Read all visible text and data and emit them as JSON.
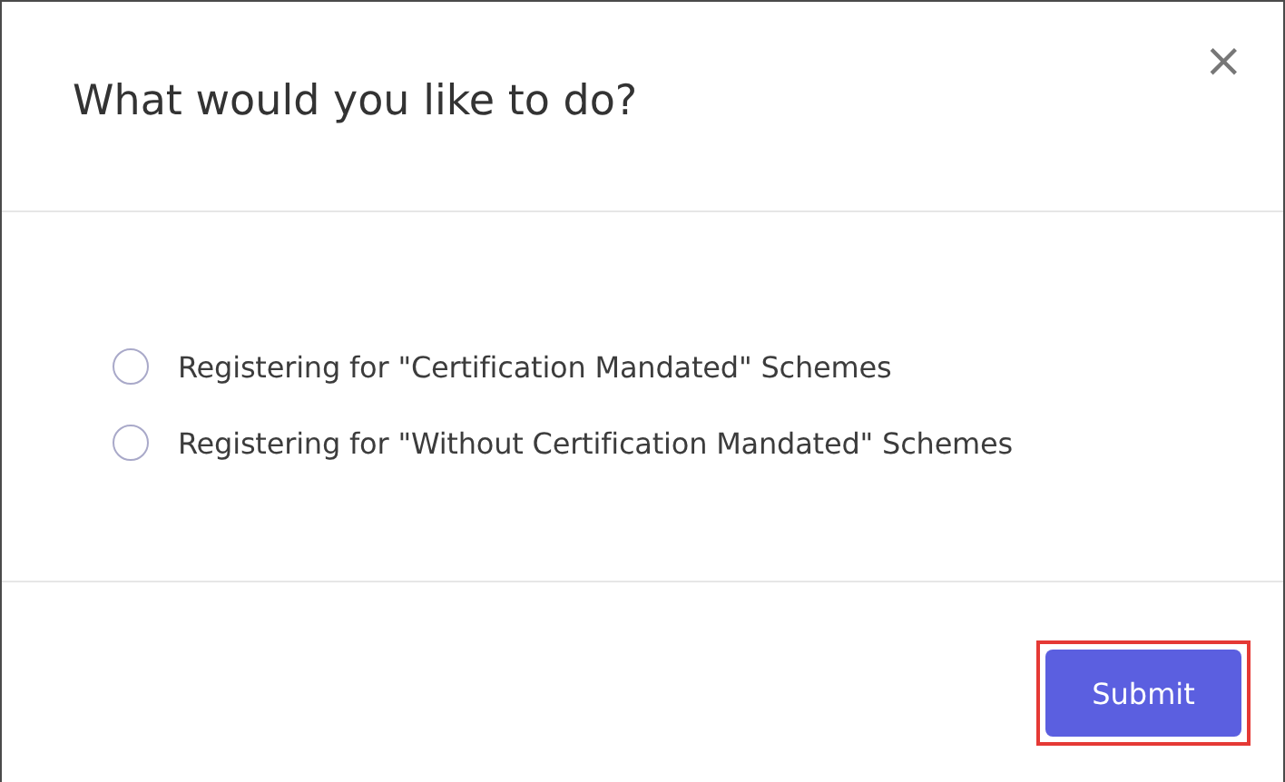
{
  "dialog": {
    "title": "What would you like to do?",
    "close": "×"
  },
  "options": [
    {
      "label": "Registering for \"Certification Mandated\" Schemes",
      "selected": false
    },
    {
      "label": "Registering for \"Without Certification Mandated\" Schemes",
      "selected": false
    }
  ],
  "submit": {
    "label": "Submit",
    "highlighted": true
  }
}
